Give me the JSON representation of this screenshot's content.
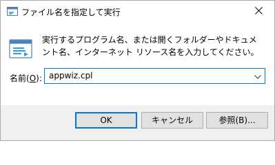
{
  "window": {
    "title": "ファイル名を指定して実行",
    "close_label": "Close"
  },
  "content": {
    "description": "実行するプログラム名、または開くフォルダーやドキュメント名、インターネット リソース名を入力してください。",
    "open_label_prefix": "名前(",
    "open_label_accel": "O",
    "open_label_suffix": "):",
    "combo_value": "appwiz.cpl"
  },
  "buttons": {
    "ok": "OK",
    "cancel": "キャンセル",
    "browse": "参照(B)..."
  },
  "icons": {
    "title": "run-icon",
    "large": "run-icon",
    "close": "close-icon",
    "dropdown": "chevron-down-icon"
  },
  "colors": {
    "accent": "#0078d7",
    "button_face": "#e1e1e1",
    "footer_bg": "#f0f0f0"
  }
}
